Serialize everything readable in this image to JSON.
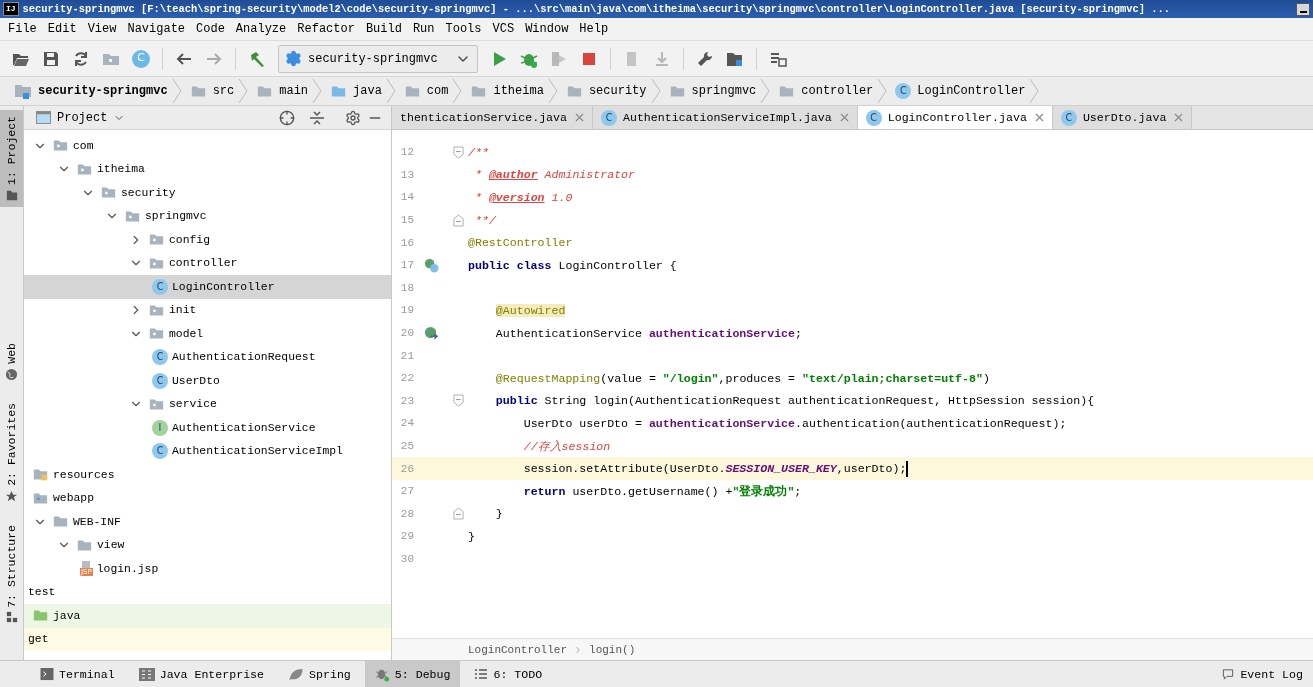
{
  "window": {
    "app_icon": "IJ",
    "title": "security-springmvc [F:\\teach\\spring-security\\model2\\code\\security-springmvc] - ...\\src\\main\\java\\com\\itheima\\security\\springmvc\\controller\\LoginController.java [security-springmvc] ..."
  },
  "menu": [
    "File",
    "Edit",
    "View",
    "Navigate",
    "Code",
    "Analyze",
    "Refactor",
    "Build",
    "Run",
    "Tools",
    "VCS",
    "Window",
    "Help"
  ],
  "toolbar": {
    "class_button_glyph": "C",
    "run_configuration": "security-springmvc"
  },
  "navigation_bar": [
    {
      "label": "security-springmvc",
      "kind": "module"
    },
    {
      "label": "src",
      "kind": "folder"
    },
    {
      "label": "main",
      "kind": "folder"
    },
    {
      "label": "java",
      "kind": "source"
    },
    {
      "label": "com",
      "kind": "package"
    },
    {
      "label": "itheima",
      "kind": "package"
    },
    {
      "label": "security",
      "kind": "package"
    },
    {
      "label": "springmvc",
      "kind": "package"
    },
    {
      "label": "controller",
      "kind": "package"
    },
    {
      "label": "LoginController",
      "kind": "class",
      "glyph": "C"
    }
  ],
  "side_strip": [
    {
      "label": "1: Project",
      "kind": "project",
      "selected": true
    },
    {
      "label": "Web",
      "kind": "web",
      "selected": false
    },
    {
      "label": "2: Favorites",
      "kind": "favorites",
      "selected": false
    },
    {
      "label": "7: Structure",
      "kind": "structure",
      "selected": false
    }
  ],
  "project_panel": {
    "title": "Project",
    "tree": [
      {
        "label": "com",
        "kind": "package",
        "expanded": true,
        "selected": false,
        "children": [
          {
            "label": "itheima",
            "kind": "package",
            "expanded": true,
            "selected": false,
            "children": [
              {
                "label": "security",
                "kind": "package",
                "expanded": true,
                "selected": false,
                "children": [
                  {
                    "label": "springmvc",
                    "kind": "package",
                    "expanded": true,
                    "selected": false,
                    "children": [
                      {
                        "label": "config",
                        "kind": "package",
                        "expanded": false,
                        "selected": false
                      },
                      {
                        "label": "controller",
                        "kind": "package",
                        "expanded": true,
                        "selected": false,
                        "children": [
                          {
                            "label": "LoginController",
                            "kind": "class",
                            "glyph": "C",
                            "selected": true
                          }
                        ]
                      },
                      {
                        "label": "init",
                        "kind": "package",
                        "expanded": false,
                        "selected": false
                      },
                      {
                        "label": "model",
                        "kind": "package",
                        "expanded": true,
                        "selected": false,
                        "children": [
                          {
                            "label": "AuthenticationRequest",
                            "kind": "class",
                            "glyph": "C",
                            "selected": false
                          },
                          {
                            "label": "UserDto",
                            "kind": "class",
                            "glyph": "C",
                            "selected": false
                          }
                        ]
                      },
                      {
                        "label": "service",
                        "kind": "package",
                        "expanded": true,
                        "selected": false,
                        "children": [
                          {
                            "label": "AuthenticationService",
                            "kind": "interface",
                            "glyph": "I",
                            "selected": false
                          },
                          {
                            "label": "AuthenticationServiceImpl",
                            "kind": "class",
                            "glyph": "C",
                            "selected": false
                          }
                        ]
                      }
                    ]
                  }
                ]
              }
            ]
          }
        ]
      },
      {
        "label": "resources",
        "kind": "resources",
        "selected": false
      },
      {
        "label": "webapp",
        "kind": "web-folder",
        "selected": false
      },
      {
        "label": "WEB-INF",
        "kind": "folder",
        "expanded": true,
        "selected": false,
        "children": [
          {
            "label": "view",
            "kind": "folder",
            "expanded": true,
            "selected": false,
            "children": [
              {
                "label": "login.jsp",
                "kind": "jsp",
                "glyph": "JSP",
                "selected": false
              }
            ]
          }
        ]
      },
      {
        "label": "test",
        "kind": "text",
        "selected": false
      },
      {
        "label": "java",
        "kind": "test-source",
        "selected": false
      },
      {
        "label": "get",
        "kind": "typed",
        "selected": false
      }
    ]
  },
  "editor_tabs": [
    {
      "label": "thenticationService.java",
      "kind": "cut",
      "selected": false
    },
    {
      "label": "AuthenticationServiceImpl.java",
      "kind": "class",
      "glyph": "C",
      "selected": false
    },
    {
      "label": "LoginController.java",
      "kind": "class",
      "glyph": "C",
      "selected": true
    },
    {
      "label": "UserDto.java",
      "kind": "class",
      "glyph": "C",
      "selected": false
    }
  ],
  "code": [
    {
      "number": "12",
      "fold": {
        "kind": "start"
      },
      "tokens": [
        {
          "text": "/**",
          "kind": "doc"
        }
      ]
    },
    {
      "number": "13",
      "tokens": [
        {
          "text": " * ",
          "kind": "doc"
        },
        {
          "text": "@author",
          "kind": "doc-tag"
        },
        {
          "text": " Administrator",
          "kind": "doc"
        }
      ]
    },
    {
      "number": "14",
      "tokens": [
        {
          "text": " * ",
          "kind": "doc"
        },
        {
          "text": "@version",
          "kind": "doc-tag"
        },
        {
          "text": " 1.0",
          "kind": "doc"
        }
      ]
    },
    {
      "number": "15",
      "fold": {
        "kind": "end"
      },
      "tokens": [
        {
          "text": " **/",
          "kind": "doc"
        }
      ]
    },
    {
      "number": "16",
      "tokens": [
        {
          "text": "@RestController",
          "kind": "annotation"
        }
      ]
    },
    {
      "number": "17",
      "gutter": {
        "kind": "class"
      },
      "tokens": [
        {
          "text": "public class",
          "kind": "keyword"
        },
        {
          "text": " LoginController {",
          "kind": "plain"
        }
      ]
    },
    {
      "number": "18"
    },
    {
      "number": "19",
      "tokens": [
        {
          "text": "    @Autowired",
          "kind": "annotation-highlighted"
        }
      ]
    },
    {
      "number": "20",
      "gutter": {
        "kind": "injected"
      },
      "tokens": [
        {
          "text": "    AuthenticationService ",
          "kind": "plain"
        },
        {
          "text": "authenticationService",
          "kind": "field"
        },
        {
          "text": ";",
          "kind": "plain"
        }
      ]
    },
    {
      "number": "21"
    },
    {
      "number": "22",
      "tokens": [
        {
          "text": "    @RequestMapping",
          "kind": "annotation"
        },
        {
          "text": "(value = ",
          "kind": "plain"
        },
        {
          "text": "\"/login\"",
          "kind": "string"
        },
        {
          "text": ",produces = ",
          "kind": "plain"
        },
        {
          "text": "\"text/plain;charset=utf-8\"",
          "kind": "string"
        },
        {
          "text": ")",
          "kind": "plain"
        }
      ]
    },
    {
      "number": "23",
      "fold": {
        "kind": "start"
      },
      "tokens": [
        {
          "text": "    public",
          "kind": "keyword"
        },
        {
          "text": " String login(AuthenticationRequest authenticationRequest, HttpSession session){",
          "kind": "plain"
        }
      ]
    },
    {
      "number": "24",
      "tokens": [
        {
          "text": "        UserDto userDto = ",
          "kind": "plain"
        },
        {
          "text": "authenticationService",
          "kind": "field"
        },
        {
          "text": ".authentication(authenticationRequest);",
          "kind": "plain"
        }
      ]
    },
    {
      "number": "25",
      "tokens": [
        {
          "text": "        //存入session",
          "kind": "comment"
        }
      ]
    },
    {
      "number": "26",
      "current": true,
      "tokens": [
        {
          "text": "        session.setAttribute(UserDto.",
          "kind": "plain"
        },
        {
          "text": "SESSION_USER_KEY",
          "kind": "static"
        },
        {
          "text": ",userDto);",
          "kind": "plain"
        }
      ]
    },
    {
      "number": "27",
      "tokens": [
        {
          "text": "        return",
          "kind": "keyword"
        },
        {
          "text": " userDto.getUsername() +",
          "kind": "plain"
        },
        {
          "text": "\"登录成功\"",
          "kind": "string"
        },
        {
          "text": ";",
          "kind": "plain"
        }
      ]
    },
    {
      "number": "28",
      "fold": {
        "kind": "end"
      },
      "tokens": [
        {
          "text": "    }",
          "kind": "plain"
        }
      ]
    },
    {
      "number": "29",
      "tokens": [
        {
          "text": "}",
          "kind": "plain"
        }
      ]
    },
    {
      "number": "30"
    }
  ],
  "editor_breadcrumb": [
    "LoginController",
    "login()"
  ],
  "tool_windows": [
    {
      "label": "Terminal",
      "kind": "terminal",
      "selected": false
    },
    {
      "label": "Java Enterprise",
      "kind": "enterprise",
      "selected": false
    },
    {
      "label": "Spring",
      "kind": "spring",
      "selected": false
    },
    {
      "label": "5: Debug",
      "kind": "debug",
      "selected": true
    },
    {
      "label": "6: TODO",
      "kind": "todo",
      "selected": false
    },
    {
      "label": "Event Log",
      "kind": "event-log",
      "selected": false
    }
  ]
}
